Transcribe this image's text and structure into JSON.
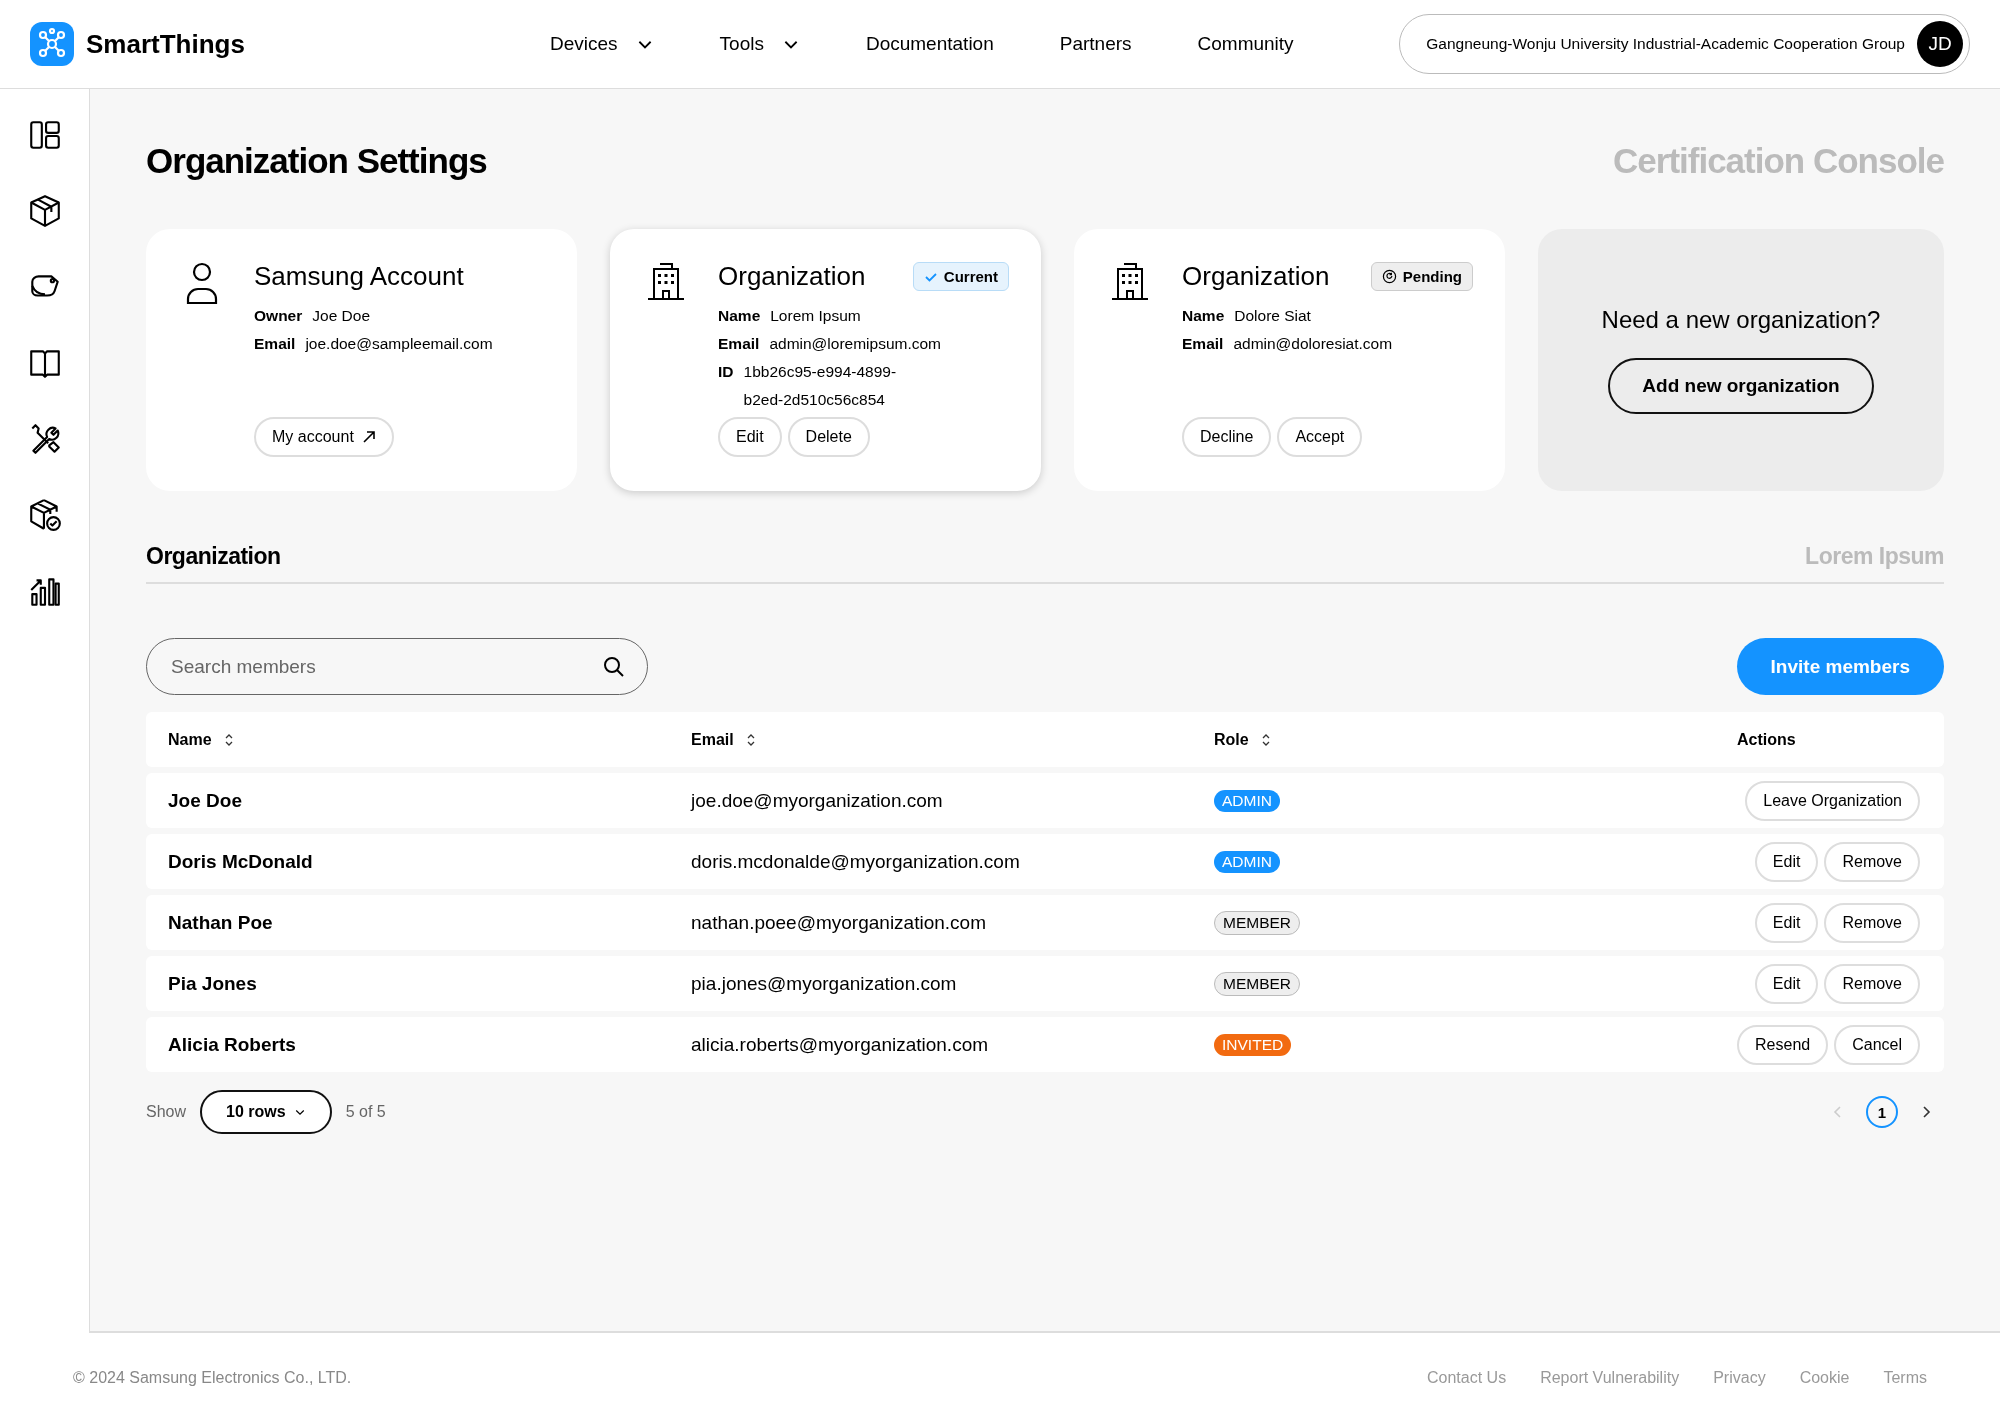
{
  "header": {
    "brand": "SmartThings",
    "nav": [
      {
        "label": "Devices",
        "dropdown": true
      },
      {
        "label": "Tools",
        "dropdown": true
      },
      {
        "label": "Documentation",
        "dropdown": false
      },
      {
        "label": "Partners",
        "dropdown": false
      },
      {
        "label": "Community",
        "dropdown": false
      }
    ],
    "org_selector": {
      "name": "Gangneung-Wonju University Industrial-Academic Cooperation Group",
      "initials": "JD"
    }
  },
  "page": {
    "title": "Organization Settings",
    "subtitle": "Certification Console"
  },
  "cards": [
    {
      "kind": "account",
      "selected": false,
      "title": "Samsung Account",
      "fields": [
        {
          "label": "Owner",
          "value": "Joe Doe"
        },
        {
          "label": "Email",
          "value": "joe.doe@sampleemail.com"
        }
      ],
      "buttons": [
        {
          "label": "My account",
          "external": true
        }
      ]
    },
    {
      "kind": "organization",
      "selected": true,
      "title": "Organization",
      "badge": {
        "kind": "current",
        "label": "Current"
      },
      "fields": [
        {
          "label": "Name",
          "value": "Lorem Ipsum"
        },
        {
          "label": "Email",
          "value": "admin@loremipsum.com"
        },
        {
          "label": "ID",
          "value": "1bb26c95-e994-4899-b2ed-2d510c56c854"
        }
      ],
      "buttons": [
        {
          "label": "Edit",
          "external": false
        },
        {
          "label": "Delete",
          "external": false
        }
      ]
    },
    {
      "kind": "organization",
      "selected": false,
      "title": "Organization",
      "badge": {
        "kind": "pending",
        "label": "Pending"
      },
      "fields": [
        {
          "label": "Name",
          "value": "Dolore Siat"
        },
        {
          "label": "Email",
          "value": "admin@doloresiat.com"
        }
      ],
      "buttons": [
        {
          "label": "Decline",
          "external": false
        },
        {
          "label": "Accept",
          "external": false
        }
      ]
    }
  ],
  "new_org": {
    "prompt": "Need a new organization?",
    "button": "Add new organization"
  },
  "section": {
    "title": "Organization",
    "org_name": "Lorem Ipsum"
  },
  "search": {
    "placeholder": "Search members"
  },
  "invite_button": "Invite members",
  "table": {
    "columns": [
      {
        "label": "Name",
        "sortable": true
      },
      {
        "label": "Email",
        "sortable": true
      },
      {
        "label": "Role",
        "sortable": true
      },
      {
        "label": "Actions",
        "sortable": false
      }
    ],
    "rows": [
      {
        "name": "Joe Doe",
        "email": "joe.doe@myorganization.com",
        "role": {
          "kind": "admin",
          "label": "ADMIN"
        },
        "actions": [
          "Leave Organization"
        ]
      },
      {
        "name": "Doris McDonald",
        "email": "doris.mcdonalde@myorganization.com",
        "role": {
          "kind": "admin",
          "label": "ADMIN"
        },
        "actions": [
          "Edit",
          "Remove"
        ]
      },
      {
        "name": "Nathan Poe",
        "email": "nathan.poee@myorganization.com",
        "role": {
          "kind": "member",
          "label": "MEMBER"
        },
        "actions": [
          "Edit",
          "Remove"
        ]
      },
      {
        "name": "Pia Jones",
        "email": "pia.jones@myorganization.com",
        "role": {
          "kind": "member",
          "label": "MEMBER"
        },
        "actions": [
          "Edit",
          "Remove"
        ]
      },
      {
        "name": "Alicia Roberts",
        "email": "alicia.roberts@myorganization.com",
        "role": {
          "kind": "invited",
          "label": "INVITED"
        },
        "actions": [
          "Resend",
          "Cancel"
        ]
      }
    ]
  },
  "pagination": {
    "show_label": "Show",
    "rows_select": "10 rows",
    "count": "5 of 5",
    "prev_disabled": true,
    "next_disabled": false,
    "pages": [
      {
        "label": "1",
        "selected": true
      }
    ]
  },
  "footer": {
    "copyright": "© 2024 Samsung Electronics Co., LTD.",
    "links": [
      "Contact Us",
      "Report Vulnerability",
      "Privacy",
      "Cookie",
      "Terms"
    ]
  }
}
